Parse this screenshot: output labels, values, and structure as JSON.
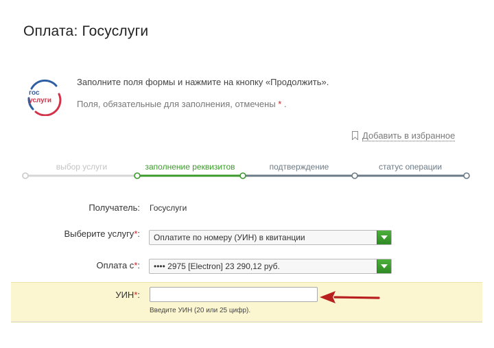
{
  "page": {
    "title": "Оплата: Госуслуги"
  },
  "logo": {
    "line1": "гос",
    "line2": "услуги",
    "ring_blue": "#2f5fa3",
    "ring_red": "#d2334a",
    "text_blue": "#2f5fa3",
    "text_red": "#d2334a"
  },
  "intro": {
    "instruction": "Заполните поля формы и нажмите на кнопку «Продолжить».",
    "required_note": "Поля, обязательные для заполнения, отмечены",
    "required_star": "*",
    "required_end": "."
  },
  "favorite": {
    "label": "Добавить в избранное",
    "icon": "bookmark-icon"
  },
  "steps": [
    {
      "label": "выбор услуги",
      "state": "done"
    },
    {
      "label": "заполнение реквизитов",
      "state": "active"
    },
    {
      "label": "подтверждение",
      "state": "todo"
    },
    {
      "label": "статус операции",
      "state": "todo"
    }
  ],
  "colors": {
    "done": "#c9c9c9",
    "active": "#3c9a2c",
    "todo": "#6b7b87",
    "required": "#d21f1f",
    "highlight": "#fbf6cf",
    "arrow": "#b81f1f"
  },
  "form": {
    "recipient_label": "Получатель:",
    "recipient_value": "Госуслуги",
    "service_label": "Выберите услугу",
    "service_req": "*",
    "service_colon": ":",
    "service_value": "Оплатите по номеру (УИН) в квитанции",
    "payfrom_label": "Оплата с",
    "payfrom_req": "*",
    "payfrom_colon": ":",
    "payfrom_value": "•••• 2975 [Electron] 23 290,12 руб.",
    "uin_label": "УИН",
    "uin_req": "*",
    "uin_colon": ":",
    "uin_value": "",
    "uin_hint": "Введите УИН (20 или 25 цифр)."
  }
}
